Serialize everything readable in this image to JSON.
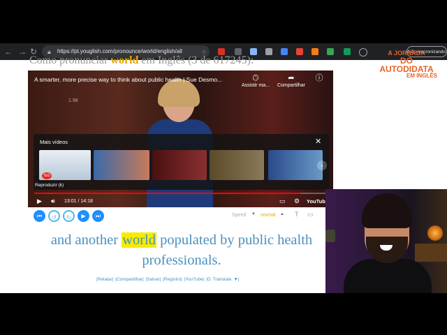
{
  "browser": {
    "url": "https://pt.youglish.com/pronounce/world/english/all",
    "sync_label": "Não sincronizando"
  },
  "logo": {
    "line1": "A JORNADA",
    "line2": "DO AUTODIDATA",
    "line3": "EM INGLÊS",
    "color": "#e8632a"
  },
  "page": {
    "heading_prefix": "Como pronunciar",
    "heading_word": "world",
    "heading_suffix": "em Inglês (3 de 617245):"
  },
  "video": {
    "title": "A smarter, more precise way to think about public health | Sue Desmo...",
    "watch_later": "Assistir ma...",
    "share": "Compartilhar",
    "more_videos_title": "Mais vídeos",
    "play_tooltip": "Reproduzir (k)",
    "time": "13:01 / 14:18",
    "progress_fraction": 0.91,
    "brand": "YouTube",
    "watermark": "1.98",
    "ted_badge": "TED"
  },
  "controls": {
    "speed_label": "Speed",
    "speed_value": "normal"
  },
  "caption": {
    "before": "and another",
    "word": "world",
    "after": "populated by public health professionals."
  },
  "links": "|Relatar|  |Compartilhar|  |Salvar|  |Registro|  |YouTube|  |G  Translate  ▼|",
  "colors": {
    "accent_blue": "#4a90c0",
    "highlight": "#f6ec00",
    "youtube_red": "#ff0000"
  }
}
